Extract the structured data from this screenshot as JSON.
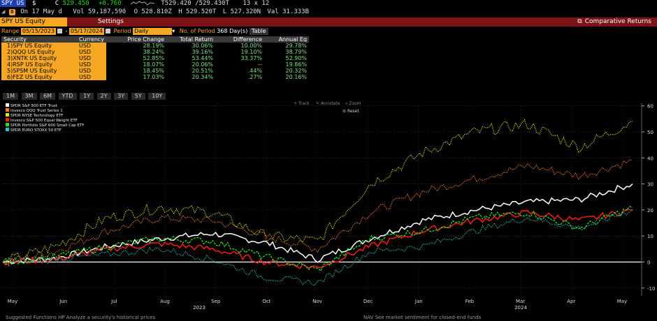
{
  "ticker": {
    "symbol": "SPY US",
    "currency_sign": "$",
    "last_label": "C",
    "last": "529.450",
    "change": "+0.760",
    "bid_ask": "T529.420 /529.430T",
    "size": "13 x 12",
    "on_date": "On 17 May d",
    "volume": "Vol 59,187,590",
    "open": "O 528.810Z",
    "high": "H 529.520T",
    "low": "L 527.320N",
    "value": "Val 31.333B"
  },
  "titlebar": {
    "security": "SPY US Equity",
    "settings": "Settings",
    "comparative": "Comparative Returns"
  },
  "controls": {
    "range_label": "Range",
    "start": "05/15/2023",
    "dash": "-",
    "end": "05/17/2024",
    "period_label": "Period",
    "period": "Daily",
    "num_label": "No. of Period",
    "num_value": "368 Day(s)",
    "table_button": "Table"
  },
  "table": {
    "headers": [
      "Security",
      "Currency",
      "Price Change",
      "Total Return",
      "Difference",
      "Annual Eq"
    ],
    "rows": [
      {
        "idx": "1)",
        "security": "SPY US Equity",
        "currency": "USD",
        "price_change": "28.19%",
        "total_return": "30.06%",
        "difference": "10.00%",
        "annual_eq": "29.78%"
      },
      {
        "idx": "2)",
        "security": "QQQ US Equity",
        "currency": "USD",
        "price_change": "38.24%",
        "total_return": "39.16%",
        "difference": "19.10%",
        "annual_eq": "38.79%"
      },
      {
        "idx": "3)",
        "security": "XNTK US Equity",
        "currency": "USD",
        "price_change": "52.85%",
        "total_return": "53.44%",
        "difference": "33.37%",
        "annual_eq": "52.90%"
      },
      {
        "idx": "4)",
        "security": "RSP US Equity",
        "currency": "USD",
        "price_change": "18.07%",
        "total_return": "20.06%",
        "difference": "--",
        "annual_eq": "19.86%"
      },
      {
        "idx": "5)",
        "security": "SPSM US Equity",
        "currency": "USD",
        "price_change": "18.45%",
        "total_return": "20.51%",
        "difference": ".44%",
        "annual_eq": "20.32%"
      },
      {
        "idx": "6)",
        "security": "FEZ US Equity",
        "currency": "USD",
        "price_change": "17.03%",
        "total_return": "20.34%",
        "difference": ".27%",
        "annual_eq": "20.16%"
      }
    ]
  },
  "periods": [
    "1M",
    "3M",
    "6M",
    "YTD",
    "1Y",
    "2Y",
    "3Y",
    "5Y",
    "10Y"
  ],
  "chart_toolbar": {
    "track": "Track",
    "annotate": "Annotate",
    "zoom": "Zoom",
    "reset": "Reset"
  },
  "chart_data": {
    "type": "line",
    "ylim": [
      -13,
      61
    ],
    "y_ticks": [
      60,
      50,
      40,
      30,
      20,
      10,
      0,
      -10
    ],
    "x_labels": [
      "May",
      "Jun",
      "Jul",
      "Aug",
      "Sep",
      "Oct",
      "Nov",
      "Dec",
      "Jan",
      "Feb",
      "Mar",
      "Apr",
      "May"
    ],
    "year_labels": [
      "2023",
      "2024"
    ],
    "series": [
      {
        "name": "SPDR S&P 500 ETF Trust",
        "color": "#ffffff",
        "style": "solid",
        "values": [
          0,
          1.5,
          6,
          9,
          11,
          7.5,
          1,
          9,
          16,
          20,
          23,
          24,
          30
        ]
      },
      {
        "name": "Invesco QQQ Trust Series 1",
        "color": "#ff7f1e",
        "style": "dotted",
        "values": [
          0,
          4,
          12,
          17,
          16,
          10,
          5,
          19,
          27,
          32,
          37,
          33,
          39
        ]
      },
      {
        "name": "SPDR NYSE Technology ETF",
        "color": "#e0e020",
        "style": "dotted",
        "values": [
          0,
          6,
          17,
          21,
          19,
          10,
          8,
          30,
          42,
          50,
          53,
          44,
          54
        ]
      },
      {
        "name": "Invesco S&P 500 Equal Weight ETF",
        "color": "#ff1a1a",
        "style": "solid",
        "values": [
          0,
          1,
          5,
          7,
          5,
          0,
          -2,
          6,
          12,
          16,
          19,
          16,
          20
        ]
      },
      {
        "name": "SPDR Portfolio S&P 600 Small Cap ETF",
        "color": "#22dd22",
        "style": "dashed",
        "values": [
          0,
          2,
          6,
          9,
          8,
          2,
          -3,
          9,
          12,
          17,
          19,
          13,
          21
        ]
      },
      {
        "name": "SPDR EURO STOXX 50 ETF",
        "color": "#22c8c8",
        "style": "dotted",
        "values": [
          0,
          1,
          3,
          5,
          1,
          -6,
          -8,
          4,
          6,
          12,
          17,
          13,
          20
        ]
      }
    ]
  },
  "bottom": {
    "left": "Suggested Functions  HP  Analyze a security's historical prices",
    "right": "NAV  See market sentiment for closed-end funds"
  }
}
